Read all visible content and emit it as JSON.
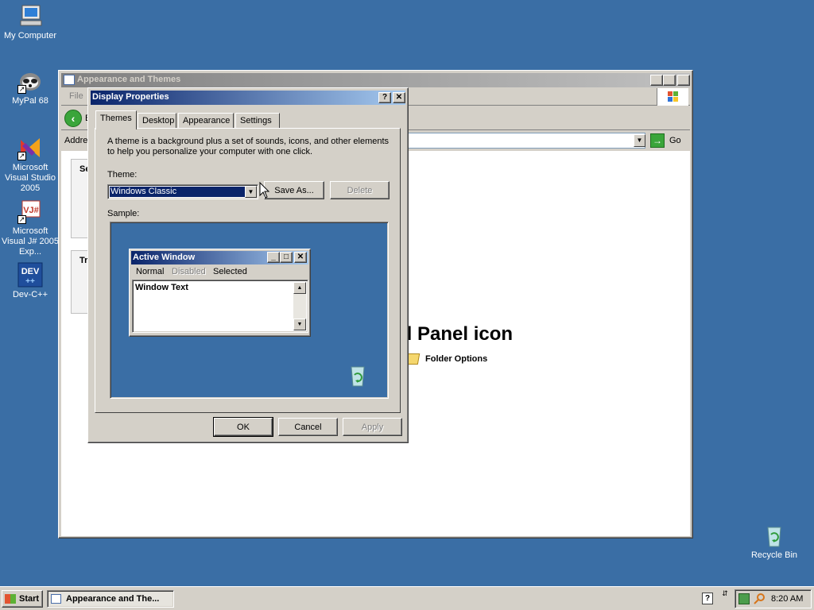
{
  "desktop": {
    "icons": [
      {
        "label": "My Computer",
        "icon": "my-computer-icon"
      },
      {
        "label": "MyPal 68",
        "icon": "mypal-icon"
      },
      {
        "label": "Microsoft Visual Studio 2005",
        "icon": "visual-studio-icon"
      },
      {
        "label": "Microsoft Visual J# 2005 Exp...",
        "icon": "visual-jsharp-icon"
      },
      {
        "label": "Dev-C++",
        "icon": "dev-cpp-icon"
      },
      {
        "label": "Recycle Bin",
        "icon": "recycle-bin-icon"
      }
    ]
  },
  "explorer": {
    "title": "Appearance and Themes",
    "menu_file": "File",
    "back_label": "B",
    "address_label": "Addre",
    "go_label": "Go",
    "side_header_1": "Se",
    "side_header_2": "Tr",
    "main_heading": "ol Panel icon",
    "folder_options": "Folder Options"
  },
  "dialog": {
    "title": "Display Properties",
    "help_button": "?",
    "close_button": "✕",
    "tabs": [
      "Themes",
      "Desktop",
      "Appearance",
      "Settings"
    ],
    "selected_tab": "Themes",
    "description": "A theme is a background plus a set of sounds, icons, and other elements to help you personalize your computer with one click.",
    "theme_label": "Theme:",
    "theme_value": "Windows Classic",
    "save_as": "Save As...",
    "delete": "Delete",
    "sample_label": "Sample:",
    "sample_window": {
      "title": "Active Window",
      "menu": [
        "Normal",
        "Disabled",
        "Selected"
      ],
      "text": "Window Text"
    },
    "ok": "OK",
    "cancel": "Cancel",
    "apply": "Apply"
  },
  "taskbar": {
    "start": "Start",
    "task": "Appearance and The...",
    "clock": "8:20 AM"
  },
  "colors": {
    "desktop": "#3a6ea5",
    "face": "#d4d0c8",
    "active_title_start": "#0a246a",
    "active_title_end": "#a6caf0",
    "selection": "#0a246a"
  }
}
